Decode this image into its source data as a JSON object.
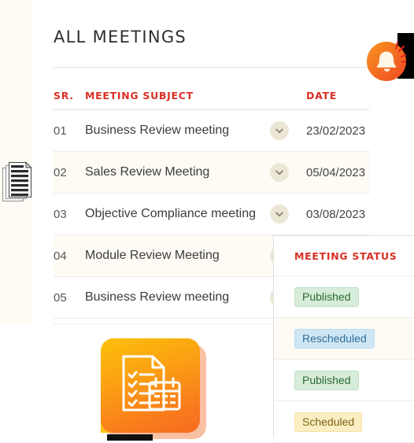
{
  "page": {
    "title": "ALL MEETINGS"
  },
  "table": {
    "columns": {
      "sr": "SR.",
      "subject": "MEETING SUBJECT",
      "date": "DATE"
    },
    "rows": [
      {
        "sr": "01",
        "subject": "Business Review meeting",
        "date": "23/02/2023",
        "expand_icon": "chevron-down-icon"
      },
      {
        "sr": "02",
        "subject": "Sales Review Meeting",
        "date": "05/04/2023",
        "expand_icon": "chevron-down-icon"
      },
      {
        "sr": "03",
        "subject": "Objective Compliance meeting",
        "date": "03/08/2023",
        "expand_icon": "chevron-down-icon"
      },
      {
        "sr": "04",
        "subject": "Module Review Meeting",
        "date": "",
        "expand_icon": "chevron-down-icon"
      },
      {
        "sr": "05",
        "subject": "Business Review meeting",
        "date": "",
        "expand_icon": "chevron-down-icon"
      }
    ]
  },
  "status_panel": {
    "header": "MEETING STATUS",
    "rows": [
      {
        "label": "Published",
        "variant": "published"
      },
      {
        "label": "Rescheduled",
        "variant": "rescheduled"
      },
      {
        "label": "Published",
        "variant": "published"
      },
      {
        "label": "Scheduled",
        "variant": "scheduled"
      }
    ]
  },
  "icons": {
    "notification": "bell-icon",
    "documents": "documents-stack-icon",
    "checklist_tile": "checklist-calendar-icon"
  },
  "colors": {
    "accent_red": "#d93025",
    "row_alt": "#fdfbf4",
    "badge_published_bg": "#d7ecd9",
    "badge_published_text": "#2b6b34",
    "badge_rescheduled_bg": "#cfe6f5",
    "badge_rescheduled_text": "#2f6f95",
    "badge_scheduled_bg": "#fceec3",
    "badge_scheduled_text": "#7d6215",
    "tile_orange_start": "#fcc009",
    "tile_orange_end": "#f76b20",
    "bell_orange": "#f47321"
  }
}
